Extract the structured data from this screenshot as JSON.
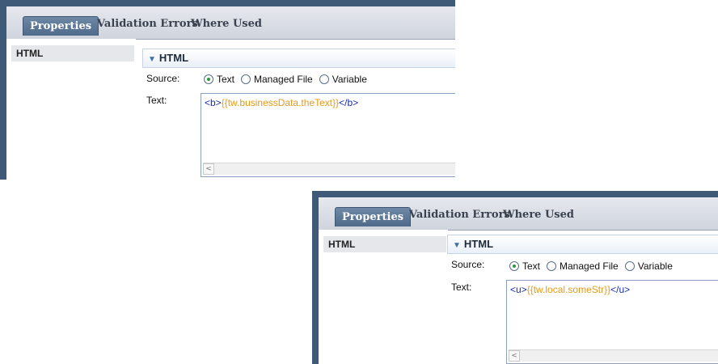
{
  "panels": [
    {
      "tabs": [
        "Properties",
        "Validation Errors",
        "Where Used"
      ],
      "sidebar_item": "HTML",
      "section_title": "HTML",
      "source_label": "Source:",
      "radio_options": [
        "Text",
        "Managed File",
        "Variable"
      ],
      "selected_option": "Text",
      "text_label": "Text:",
      "code": {
        "open_tag": "<b>",
        "expression": "{{tw.businessData.theText}}",
        "close_tag": "</b>"
      }
    },
    {
      "tabs": [
        "Properties",
        "Validation Errors",
        "Where Used"
      ],
      "sidebar_item": "HTML",
      "section_title": "HTML",
      "source_label": "Source:",
      "radio_options": [
        "Text",
        "Managed File",
        "Variable"
      ],
      "selected_option": "Text",
      "text_label": "Text:",
      "code": {
        "open_tag": "<u>",
        "expression": "{{tw.local.someStr}}",
        "close_tag": "</u>"
      }
    }
  ],
  "icons": {
    "section_toggle": "triangle-down-icon",
    "scroll_left": "scroll-left-arrow-icon"
  },
  "colors": {
    "frame": "#3f5a78",
    "active_tab": "#5d7897",
    "tag_text": "#1a2ea8",
    "expression_text": "#e69a1a",
    "radio_selected": "#2a9a3a"
  }
}
